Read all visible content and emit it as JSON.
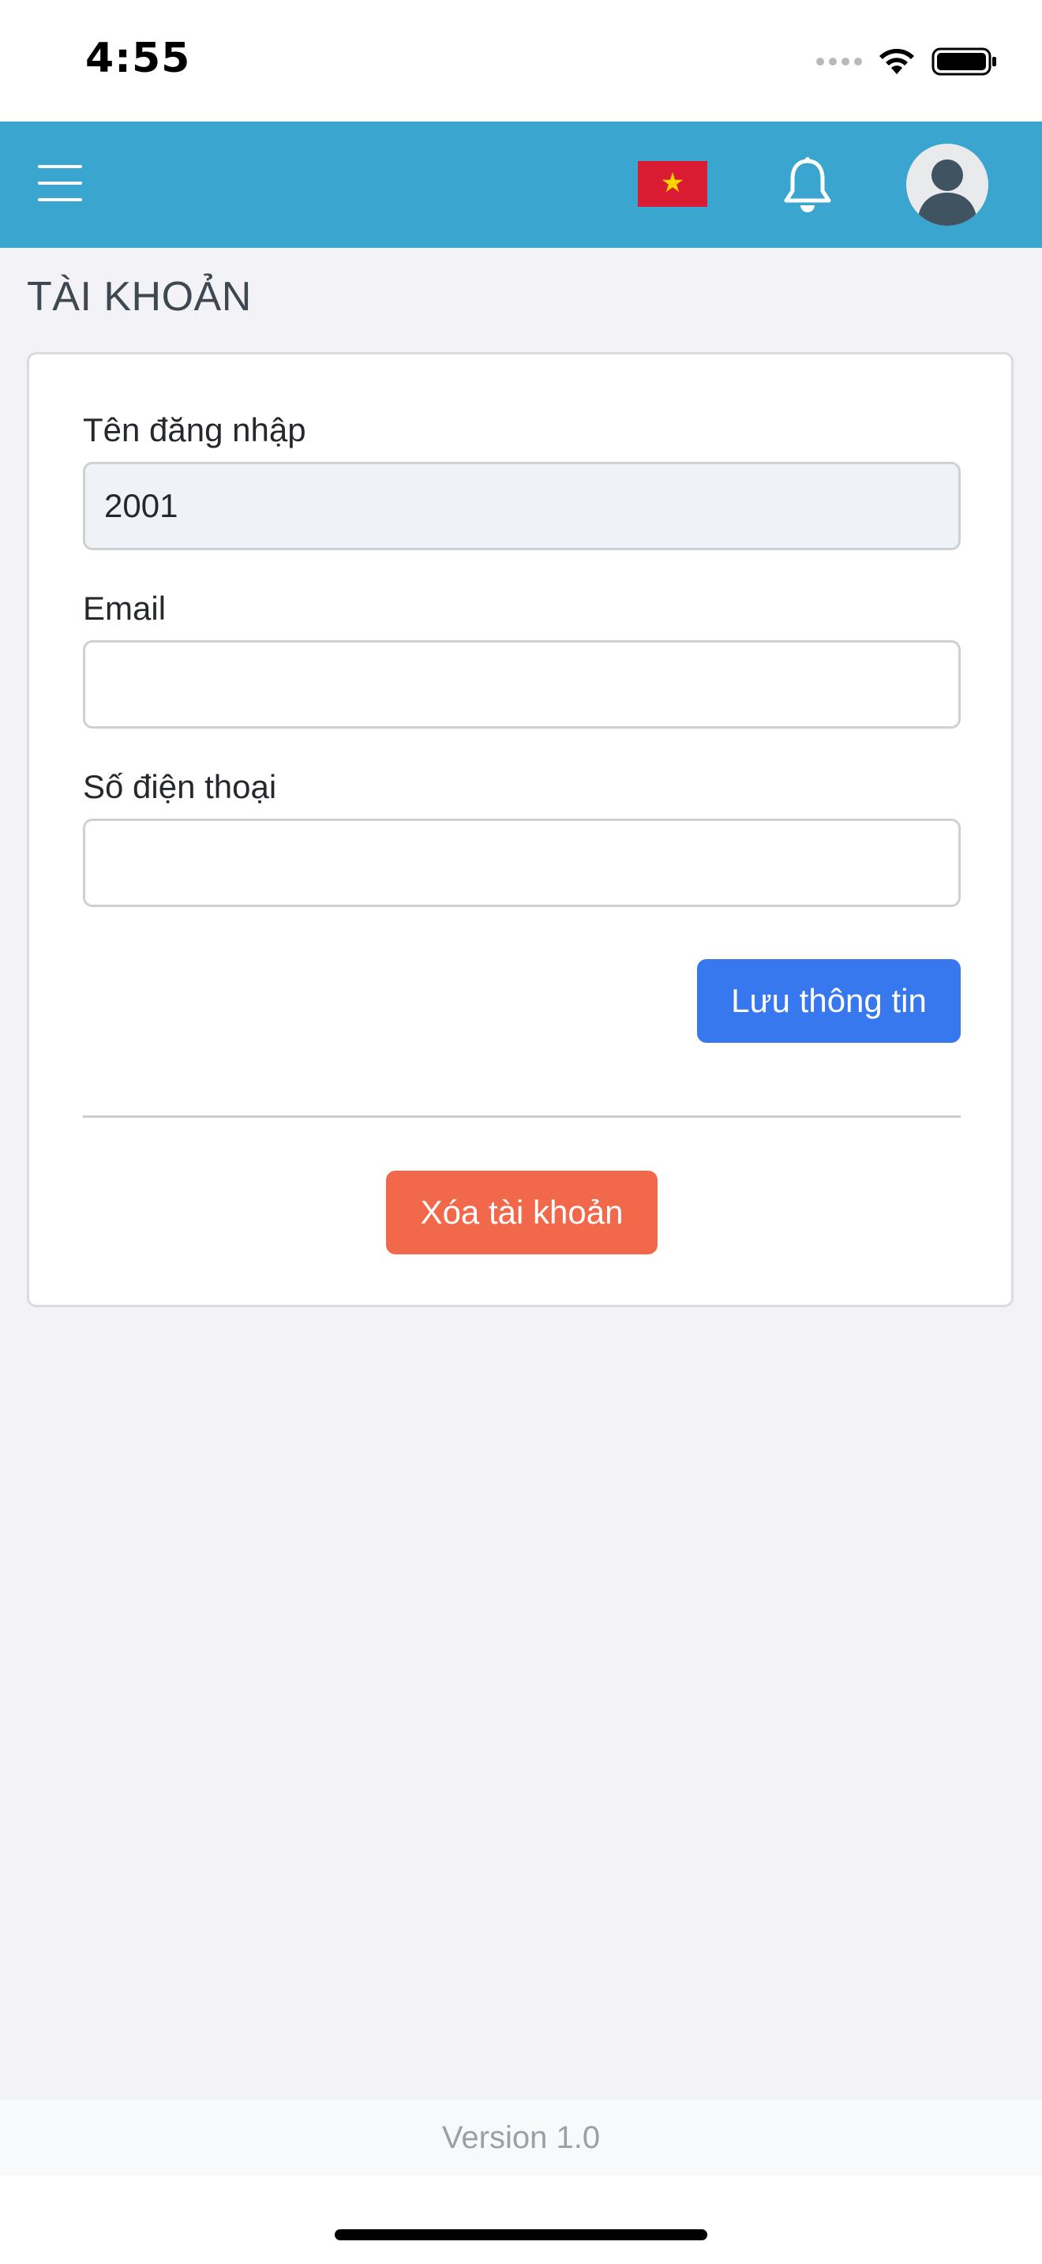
{
  "status_bar": {
    "time": "4:55",
    "icons": [
      "signal-dots-icon",
      "wifi-icon",
      "battery-icon"
    ]
  },
  "header": {
    "icons": [
      "menu-icon",
      "vietnam-flag-icon",
      "bell-icon",
      "user-avatar-icon"
    ],
    "colors": {
      "background": "#3aa6d0",
      "flag_red": "#da1c33",
      "flag_star": "#ffd400"
    }
  },
  "page": {
    "title": "TÀI KHOẢN"
  },
  "form": {
    "username": {
      "label": "Tên đăng nhập",
      "value": "2001"
    },
    "email": {
      "label": "Email",
      "value": ""
    },
    "phone": {
      "label": "Số điện thoại",
      "value": ""
    },
    "save_label": "Lưu thông tin",
    "delete_label": "Xóa tài khoản",
    "colors": {
      "save_button": "#3878ee",
      "delete_button": "#f2684a"
    }
  },
  "footer": {
    "version": "Version 1.0"
  }
}
